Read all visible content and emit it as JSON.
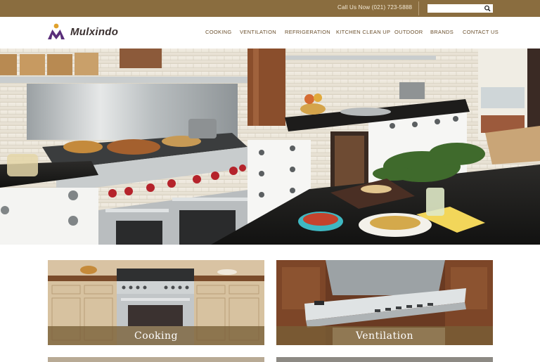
{
  "topbar": {
    "phone": "Call Us Now  (021) 723-5888",
    "search_placeholder": "",
    "icon": "search-icon"
  },
  "brand": {
    "name": "Mulxindo",
    "logo_icon": "mulxindo-logo-icon"
  },
  "nav": {
    "items": [
      {
        "label": "COOKING"
      },
      {
        "label": "VENTILATION"
      },
      {
        "label": "REFRIGERATION"
      },
      {
        "label": "KITCHEN CLEAN UP"
      },
      {
        "label": "OUTDOOR"
      },
      {
        "label": "BRANDS"
      },
      {
        "label": "CONTACT US"
      }
    ]
  },
  "hero": {
    "slides_total": 4,
    "active_slide": 1
  },
  "tiles": [
    {
      "label": "Cooking"
    },
    {
      "label": "Ventilation"
    }
  ],
  "colors": {
    "topbar": "#8a6d3f",
    "nav_text": "#6a4f2c",
    "dot_active": "#e8a12a",
    "tile_band": "#785f37"
  }
}
